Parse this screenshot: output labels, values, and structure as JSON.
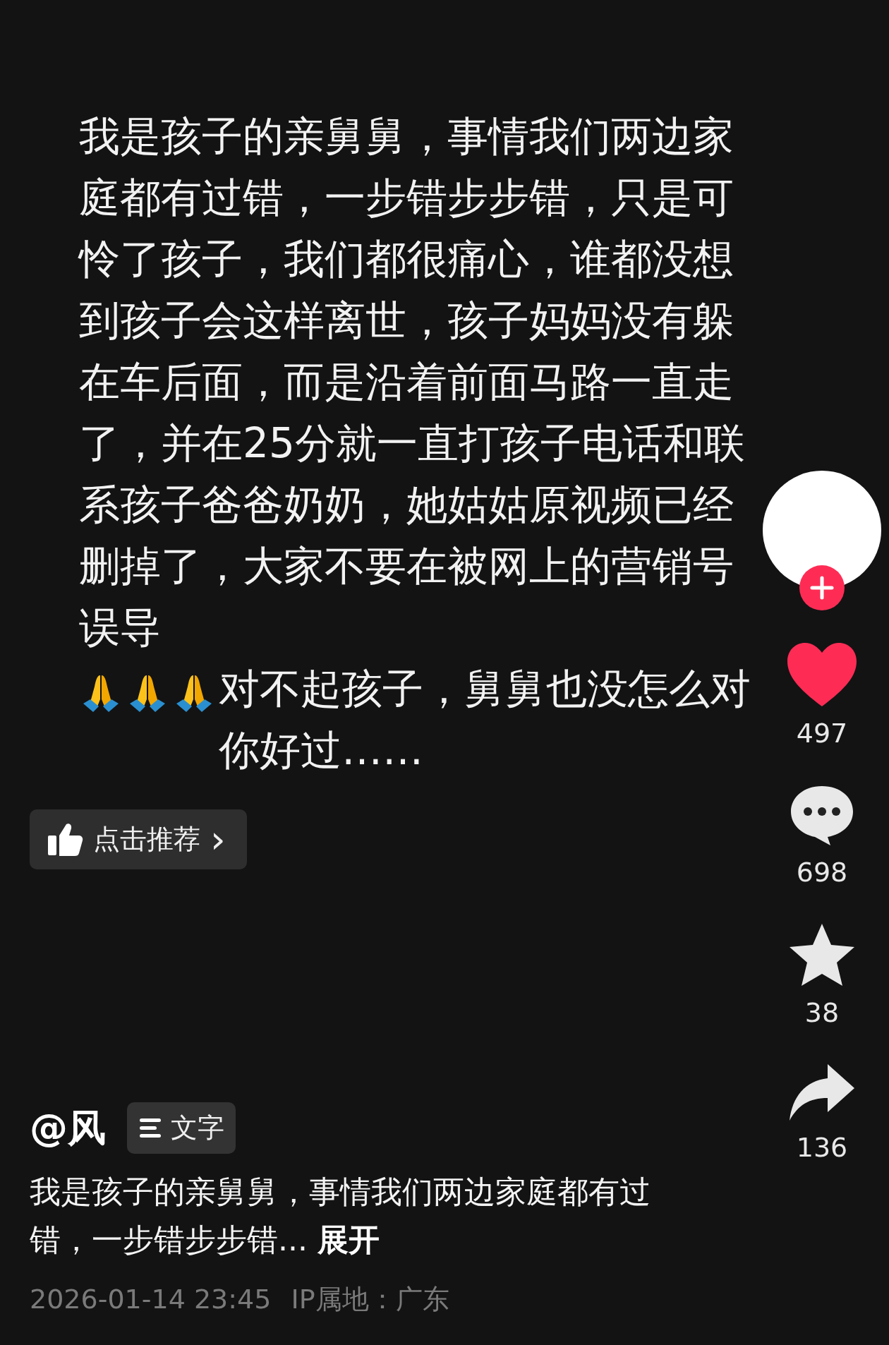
{
  "post_body": [
    {
      "kind": "text",
      "text": "我是孩子的亲舅舅，事情我们两边家庭都有过错，一步错步步错，只是可怜了孩子，我们都很痛心，谁都没想到孩子会这样离世，孩子妈妈没有躲在车后面，而是沿着前面马路一直走了，并在25分就一直打孩子电话和联系孩子爸爸奶奶，她姑姑原视频已经删掉了，大家不要在被网上的营销号误导"
    },
    {
      "kind": "emoji"
    },
    {
      "kind": "emoji"
    },
    {
      "kind": "emoji"
    },
    {
      "kind": "text",
      "text": "对不起孩子，舅舅也没怎么对你好过……"
    }
  ],
  "recommend_button": {
    "label": "点击推荐",
    "chevron": "›"
  },
  "author": {
    "handle": "@风",
    "tag": "文字"
  },
  "description": {
    "text": "我是孩子的亲舅舅，事情我们两边家庭都有过错，一步错步步错...",
    "expand": "展开"
  },
  "meta": {
    "datetime": "2026-01-14 23:45",
    "location": "IP属地：广东"
  },
  "actions": [
    {
      "kind": "like",
      "count": "497",
      "selected": true
    },
    {
      "kind": "comment",
      "count": "698"
    },
    {
      "kind": "favorite",
      "count": "38",
      "selected": false
    },
    {
      "kind": "share",
      "count": "136"
    }
  ]
}
